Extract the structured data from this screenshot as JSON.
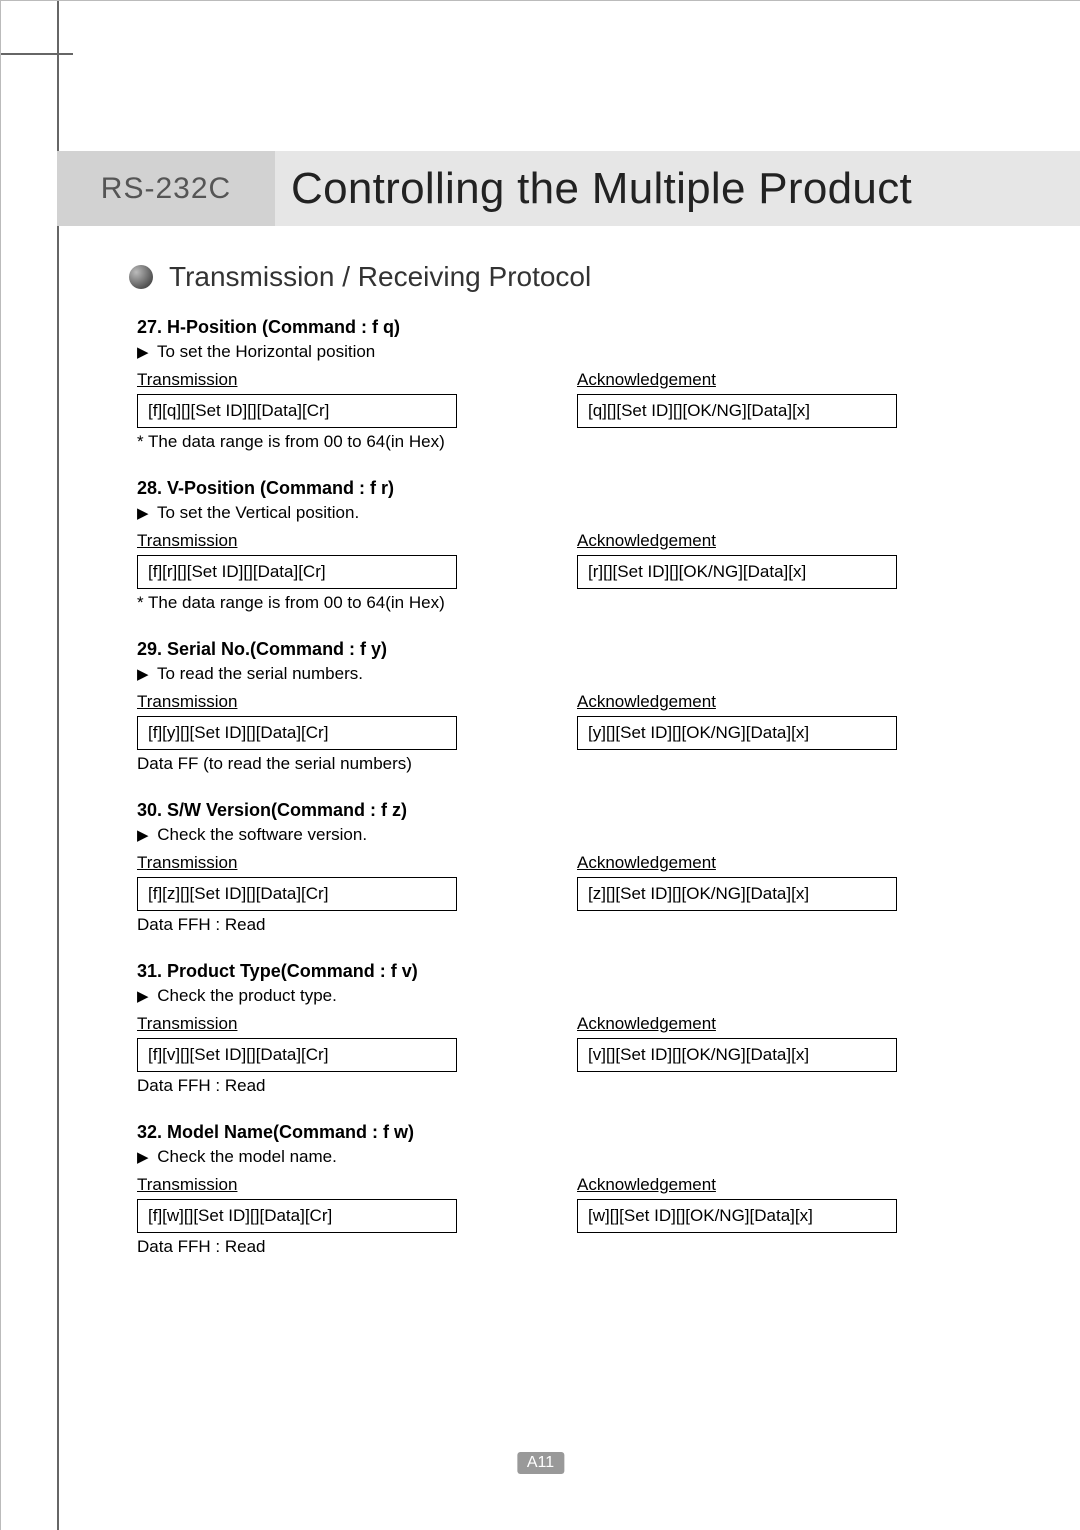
{
  "header": {
    "badge": "RS-232C",
    "title": "Controlling the Multiple Product"
  },
  "section_title": "Transmission / Receiving Protocol",
  "labels": {
    "transmission": "Transmission",
    "acknowledgement": "Acknowledgement"
  },
  "commands": [
    {
      "heading": "27. H-Position (Command : f q)",
      "desc": "To set the Horizontal position",
      "tx": "[f][q][][Set ID][][Data][Cr]",
      "ack": "[q][][Set ID][][OK/NG][Data][x]",
      "note": "* The data range is from 00 to 64(in Hex)"
    },
    {
      "heading": "28. V-Position (Command : f r)",
      "desc": "To set the Vertical position.",
      "tx": "[f][r][][Set ID][][Data][Cr]",
      "ack": "[r][][Set ID][][OK/NG][Data][x]",
      "note": "* The data range is from 00 to 64(in Hex)"
    },
    {
      "heading": "29. Serial No.(Command : f y)",
      "desc": "To read the serial numbers.",
      "tx": "[f][y][][Set ID][][Data][Cr]",
      "ack": "[y][][Set ID][][OK/NG][Data][x]",
      "note": "Data FF (to read the serial numbers)"
    },
    {
      "heading": "30. S/W Version(Command : f z)",
      "desc": "Check the software version.",
      "tx": "[f][z][][Set ID][][Data][Cr]",
      "ack": "[z][][Set ID][][OK/NG][Data][x]",
      "note": "Data FFH : Read"
    },
    {
      "heading": "31. Product Type(Command : f v)",
      "desc": "Check the product type.",
      "tx": "[f][v][][Set ID][][Data][Cr]",
      "ack": "[v][][Set ID][][OK/NG][Data][x]",
      "note": "Data FFH : Read"
    },
    {
      "heading": "32. Model Name(Command : f w)",
      "desc": "Check the model name.",
      "tx": "[f][w][][Set ID][][Data][Cr]",
      "ack": "[w][][Set ID][][OK/NG][Data][x]",
      "note": "Data FFH : Read"
    }
  ],
  "page_number": "A11"
}
